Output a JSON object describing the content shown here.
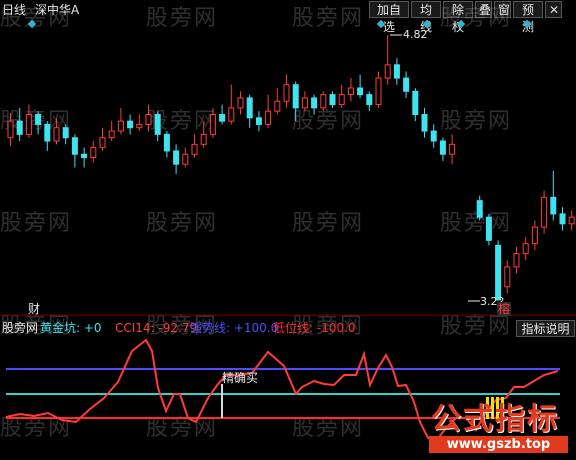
{
  "header": {
    "period": "日线",
    "stock": "深中华A"
  },
  "toolbar": [
    {
      "id": "add",
      "label": "加自选"
    },
    {
      "id": "ma",
      "label": "均线"
    },
    {
      "id": "adj",
      "label": "除权"
    },
    {
      "id": "overlay",
      "label": "叠"
    },
    {
      "id": "window",
      "label": "窗"
    },
    {
      "id": "forecast",
      "label": "预测"
    }
  ],
  "watermark": "股旁网",
  "price_annotations": {
    "high": "4.82",
    "low": "3.22"
  },
  "markers": {
    "cai": "财",
    "rong": "榕",
    "jingque": "精确买"
  },
  "indicator_legend": {
    "site": "股旁网",
    "golden_pit": "黄金坑: +0",
    "cci": "CCI14: -92.79",
    "strong_line": "强势线: +100.0",
    "low_line": "低位线: -100.0"
  },
  "indicator_button": "指标说明",
  "brand": {
    "name": "公式指标",
    "url": "www.gszb.top"
  },
  "colors": {
    "up": "#ff3b3b",
    "down": "#3fe3f0",
    "bg": "#000000",
    "strong": "#4f4cff",
    "low": "#ff2b2b",
    "cci": "#ff3b3b",
    "mid": "#34d0c8",
    "gold": "#f0e000",
    "brand": "#e23a1e"
  },
  "chart_data": {
    "type": "candlestick",
    "candles": [
      [
        4.2,
        4.3,
        4.35,
        4.15
      ],
      [
        4.3,
        4.22,
        4.38,
        4.18
      ],
      [
        4.22,
        4.34,
        4.4,
        4.2
      ],
      [
        4.34,
        4.28,
        4.36,
        4.22
      ],
      [
        4.28,
        4.18,
        4.3,
        4.12
      ],
      [
        4.18,
        4.26,
        4.32,
        4.16
      ],
      [
        4.26,
        4.2,
        4.28,
        4.16
      ],
      [
        4.2,
        4.1,
        4.22,
        4.02
      ],
      [
        4.1,
        4.08,
        4.14,
        4.02
      ],
      [
        4.08,
        4.14,
        4.18,
        4.05
      ],
      [
        4.14,
        4.2,
        4.26,
        4.12
      ],
      [
        4.2,
        4.24,
        4.3,
        4.18
      ],
      [
        4.24,
        4.3,
        4.38,
        4.22
      ],
      [
        4.3,
        4.26,
        4.34,
        4.22
      ],
      [
        4.26,
        4.28,
        4.34,
        4.24
      ],
      [
        4.28,
        4.34,
        4.4,
        4.24
      ],
      [
        4.34,
        4.22,
        4.36,
        4.18
      ],
      [
        4.22,
        4.12,
        4.24,
        4.08
      ],
      [
        4.12,
        4.04,
        4.16,
        3.98
      ],
      [
        4.04,
        4.1,
        4.14,
        4.02
      ],
      [
        4.1,
        4.16,
        4.22,
        4.08
      ],
      [
        4.16,
        4.22,
        4.3,
        4.14
      ],
      [
        4.22,
        4.34,
        4.38,
        4.2
      ],
      [
        4.34,
        4.3,
        4.4,
        4.28
      ],
      [
        4.3,
        4.38,
        4.52,
        4.28
      ],
      [
        4.38,
        4.44,
        4.48,
        4.34
      ],
      [
        4.44,
        4.32,
        4.46,
        4.26
      ],
      [
        4.32,
        4.28,
        4.36,
        4.24
      ],
      [
        4.28,
        4.36,
        4.46,
        4.26
      ],
      [
        4.36,
        4.42,
        4.5,
        4.34
      ],
      [
        4.42,
        4.52,
        4.58,
        4.38
      ],
      [
        4.52,
        4.38,
        4.54,
        4.3
      ],
      [
        4.38,
        4.44,
        4.48,
        4.36
      ],
      [
        4.44,
        4.38,
        4.46,
        4.34
      ],
      [
        4.38,
        4.46,
        4.48,
        4.36
      ],
      [
        4.46,
        4.4,
        4.48,
        4.38
      ],
      [
        4.4,
        4.46,
        4.52,
        4.38
      ],
      [
        4.46,
        4.5,
        4.56,
        4.42
      ],
      [
        4.5,
        4.46,
        4.58,
        4.44
      ],
      [
        4.46,
        4.4,
        4.48,
        4.36
      ],
      [
        4.4,
        4.56,
        4.6,
        4.38
      ],
      [
        4.56,
        4.64,
        4.82,
        4.52
      ],
      [
        4.64,
        4.56,
        4.68,
        4.52
      ],
      [
        4.56,
        4.48,
        4.6,
        4.44
      ],
      [
        4.48,
        4.34,
        4.5,
        4.3
      ],
      [
        4.34,
        4.24,
        4.38,
        4.2
      ],
      [
        4.24,
        4.18,
        4.28,
        4.14
      ],
      [
        4.18,
        4.1,
        4.2,
        4.06
      ],
      [
        4.1,
        4.16,
        4.22,
        4.04
      ],
      [
        3.82,
        3.72,
        3.85,
        3.7
      ],
      [
        3.72,
        3.58,
        3.74,
        3.55
      ],
      [
        3.55,
        3.22,
        3.58,
        3.22
      ],
      [
        3.3,
        3.42,
        3.46,
        3.26
      ],
      [
        3.42,
        3.5,
        3.54,
        3.38
      ],
      [
        3.5,
        3.56,
        3.6,
        3.46
      ],
      [
        3.56,
        3.66,
        3.7,
        3.52
      ],
      [
        3.66,
        3.84,
        3.88,
        3.62
      ],
      [
        3.84,
        3.74,
        4.0,
        3.7
      ],
      [
        3.74,
        3.68,
        3.78,
        3.64
      ],
      [
        3.68,
        3.72,
        3.76,
        3.64
      ],
      [
        3.72,
        3.78,
        3.82,
        3.7
      ],
      [
        3.78,
        3.8,
        3.84,
        3.74
      ],
      [
        3.8,
        3.86,
        3.88,
        3.78
      ],
      [
        3.86,
        3.82,
        3.94,
        3.8
      ]
    ]
  }
}
